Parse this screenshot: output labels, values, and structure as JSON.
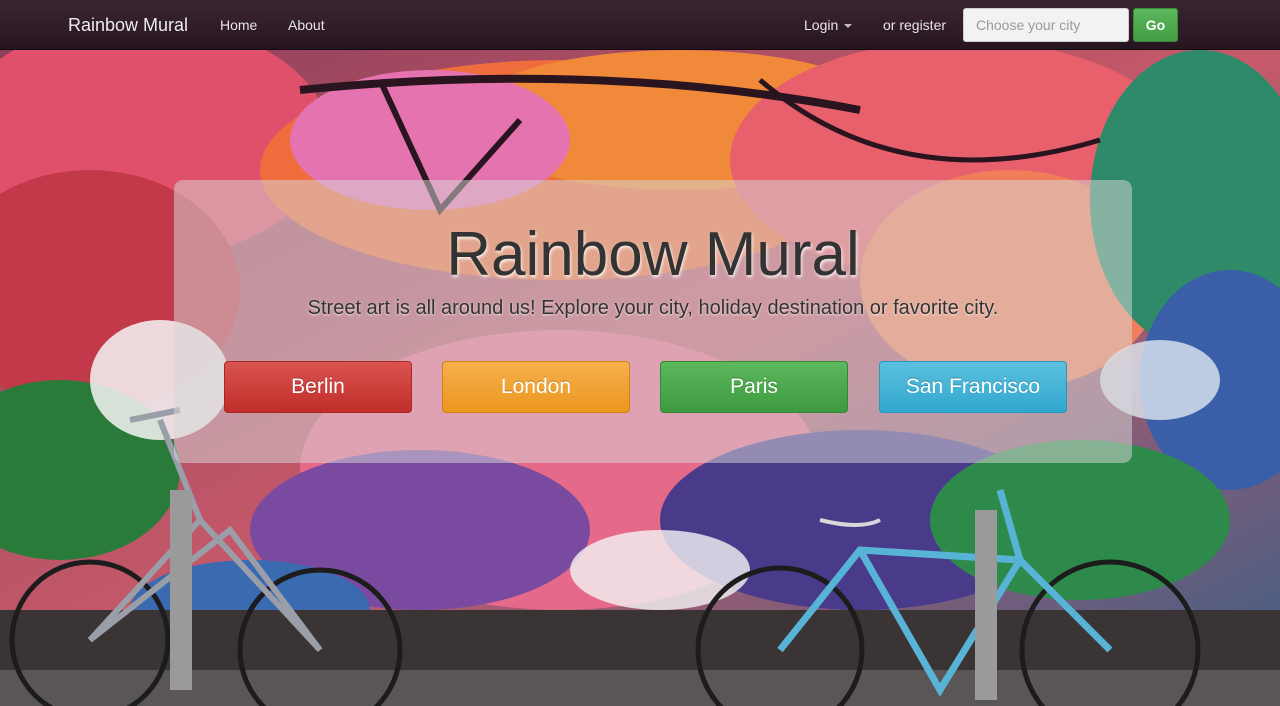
{
  "navbar": {
    "brand": "Rainbow Mural",
    "links": [
      {
        "label": "Home"
      },
      {
        "label": "About"
      }
    ],
    "login_label": "Login",
    "register_label": "or register",
    "search": {
      "placeholder": "Choose your city",
      "value": ""
    },
    "go_label": "Go"
  },
  "hero": {
    "title": "Rainbow Mural",
    "subtitle": "Street art is all around us! Explore your city, holiday destination or favorite city.",
    "cities": [
      {
        "label": "Berlin",
        "color": "#d9534f"
      },
      {
        "label": "London",
        "color": "#f0ad4e"
      },
      {
        "label": "Paris",
        "color": "#5cb85c"
      },
      {
        "label": "San Francisco",
        "color": "#5bc0de"
      }
    ]
  },
  "icons": {
    "login_dropdown": "caret-down-icon"
  }
}
